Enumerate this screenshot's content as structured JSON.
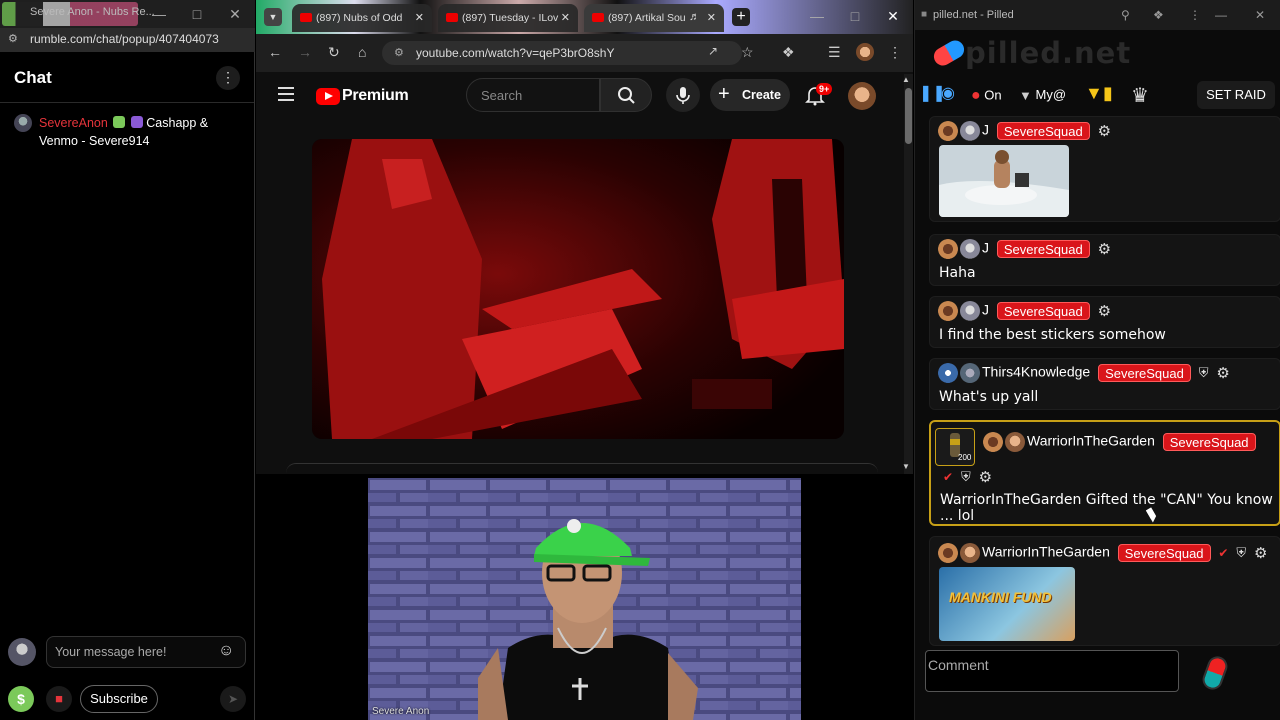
{
  "rumble": {
    "window_title": "Severe Anon - Nubs Re...",
    "url": "rumble.com/chat/popup/407404073",
    "chat_title": "Chat",
    "message": {
      "user": "SevereAnon",
      "text": "Cashapp & Venmo - Severe914"
    },
    "input_placeholder": "Your message here!",
    "subscribe_label": "Subscribe",
    "dollar_label": "$"
  },
  "youtube": {
    "tabs": [
      {
        "label": "(897) Nubs of Odd"
      },
      {
        "label": "(897) Tuesday - ILov"
      },
      {
        "label": "(897) Artikal Sou"
      }
    ],
    "url": "youtube.com/watch?v=qeP3brO8shY",
    "brand": "Premium",
    "search_placeholder": "Search",
    "create_label": "Create",
    "notification_count": "9+",
    "cam_label": "Severe Anon"
  },
  "pilled": {
    "window_title": "pilled.net - Pilled",
    "logo": "pilled.net",
    "toolbar": {
      "on_label": "On",
      "my_label": "My@",
      "set_raid_label": "SET RAID"
    },
    "squad_label": "SevereSquad",
    "messages": [
      {
        "user": "J",
        "text": ""
      },
      {
        "user": "J",
        "text": "Haha"
      },
      {
        "user": "J",
        "text": "I find the best stickers somehow"
      },
      {
        "user": "Thirs4Knowledge",
        "text": "What's up yall"
      },
      {
        "user": "WarriorInTheGarden",
        "text": "WarriorInTheGarden Gifted the \"CAN\" You know ... lol"
      },
      {
        "user": "WarriorInTheGarden",
        "text": ""
      }
    ],
    "sticker_caption": "MANKINI FUND",
    "gift_badge": "200",
    "comment_placeholder": "Comment"
  },
  "colors": {
    "squad_red": "#d9151a",
    "highlight_gold": "#c7a017",
    "rumble_green": "#7bc95a",
    "youtube_red": "#ff0000"
  }
}
